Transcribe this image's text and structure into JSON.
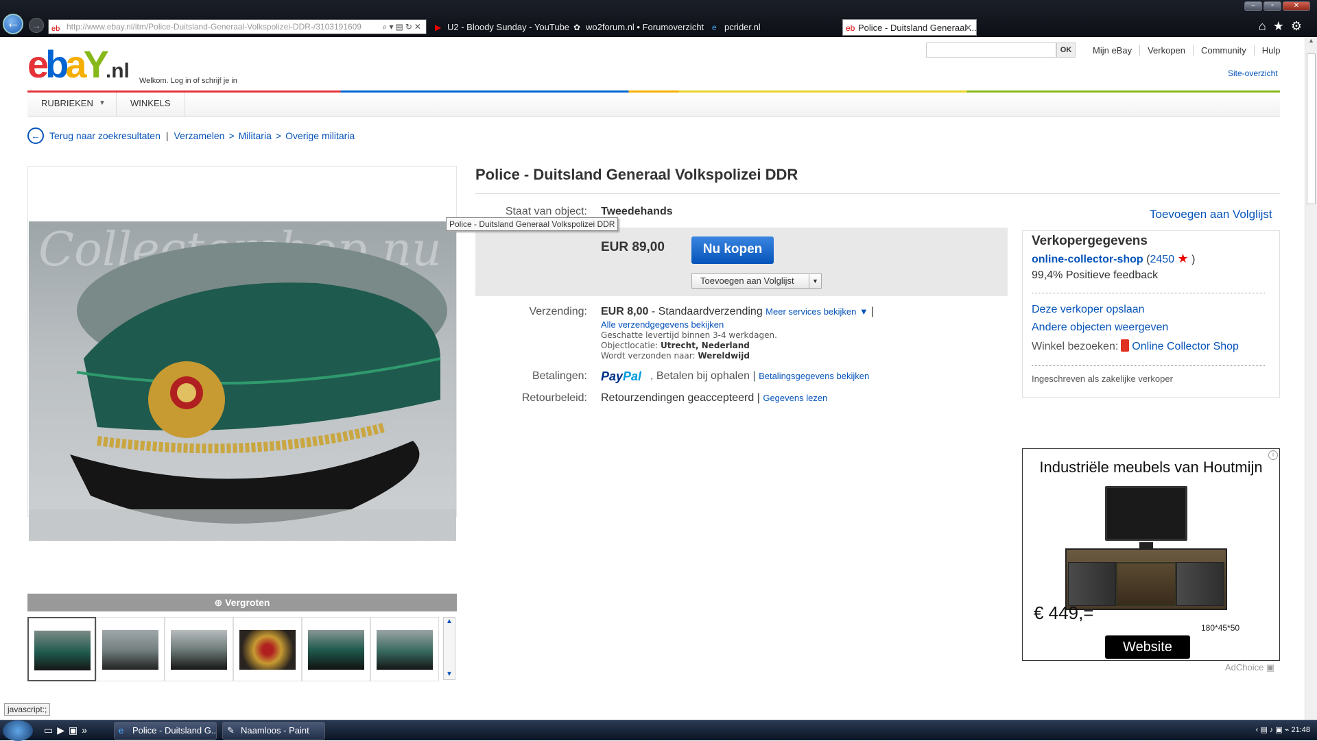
{
  "browser": {
    "address": "http://www.ebay.nl/itm/Police-Duitsland-Generaal-Volkspolizei-DDR-/3103191609",
    "address_host": "ebay.nl",
    "tabs": [
      {
        "label": "U2 - Bloody Sunday - YouTube"
      },
      {
        "label": "wo2forum.nl • Forumoverzicht"
      },
      {
        "label": "pcrider.nl"
      },
      {
        "label": "Police - Duitsland Generaal ..."
      }
    ]
  },
  "header": {
    "logo_text": "ebY",
    "logo_tld": ".nl",
    "welcome": "Welkom.",
    "signin": "Log in of schrijf je in",
    "search_button": "OK",
    "links": [
      "Mijn eBay",
      "Verkopen",
      "Community",
      "Hulp"
    ],
    "site_map": "Site-overzicht"
  },
  "nav": {
    "categories": "RUBRIEKEN",
    "shops": "WINKELS"
  },
  "breadcrumb": {
    "back": "Terug naar zoekresultaten",
    "path": [
      "Verzamelen",
      "Militaria",
      "Overige militaria"
    ]
  },
  "gallery": {
    "watermark": "Collectorshop.nu",
    "enlarge": "Vergroten",
    "thumb_count": 6
  },
  "item": {
    "title": "Police - Duitsland Generaal Volkspolizei DDR",
    "tooltip": "Police - Duitsland Generaal Volkspolizei DDR",
    "condition_label": "Staat van object:",
    "condition": "Tweedehands",
    "watch_link": "Toevoegen aan Volglijst",
    "price": "EUR 89,00",
    "buy_now": "Nu kopen",
    "watch_button": "Toevoegen aan Volglijst"
  },
  "shipping": {
    "label": "Verzending:",
    "cost": "EUR 8,00",
    "method": "- Standaardverzending",
    "more_services": "Meer services bekijken",
    "all_details": "Alle verzendgegevens bekijken",
    "delivery": "Geschatte levertijd binnen 3-4 werkdagen.",
    "location_label": "Objectlocatie:",
    "location": "Utrecht, Nederland",
    "ships_to_label": "Wordt verzonden naar:",
    "ships_to": "Wereldwijd"
  },
  "payments": {
    "label": "Betalingen:",
    "paypal_pay": "Pay",
    "paypal_pal": "Pal",
    "pickup": ", Betalen bij ophalen |",
    "details": "Betalingsgegevens bekijken"
  },
  "returns": {
    "label": "Retourbeleid:",
    "text": "Retourzendingen geaccepteerd |",
    "details": "Gegevens lezen"
  },
  "seller": {
    "heading": "Verkopergegevens",
    "name": "online-collector-shop",
    "score_open": "(",
    "score": "2450",
    "score_close": ")",
    "feedback": "99,4% Positieve feedback",
    "save": "Deze verkoper opslaan",
    "other_items": "Andere objecten weergeven",
    "visit_shop_label": "Winkel bezoeken:",
    "shop_name": "Online Collector Shop",
    "registered": "Ingeschreven als zakelijke verkoper"
  },
  "ad": {
    "headline": "Industriële meubels van Houtmijn",
    "price": "€ 449,=",
    "dimensions": "180*45*50",
    "button": "Website",
    "adchoice": "AdChoice"
  },
  "status": {
    "text": "javascript:;"
  },
  "taskbar": {
    "tasks": [
      "Police - Duitsland G...",
      "Naamloos - Paint"
    ],
    "clock": "21:48"
  },
  "colors": {
    "ebay_red": "#e53238",
    "ebay_blue": "#0064d2",
    "ebay_yellow": "#f5af02",
    "ebay_green": "#86b817",
    "link": "#0654ba"
  }
}
